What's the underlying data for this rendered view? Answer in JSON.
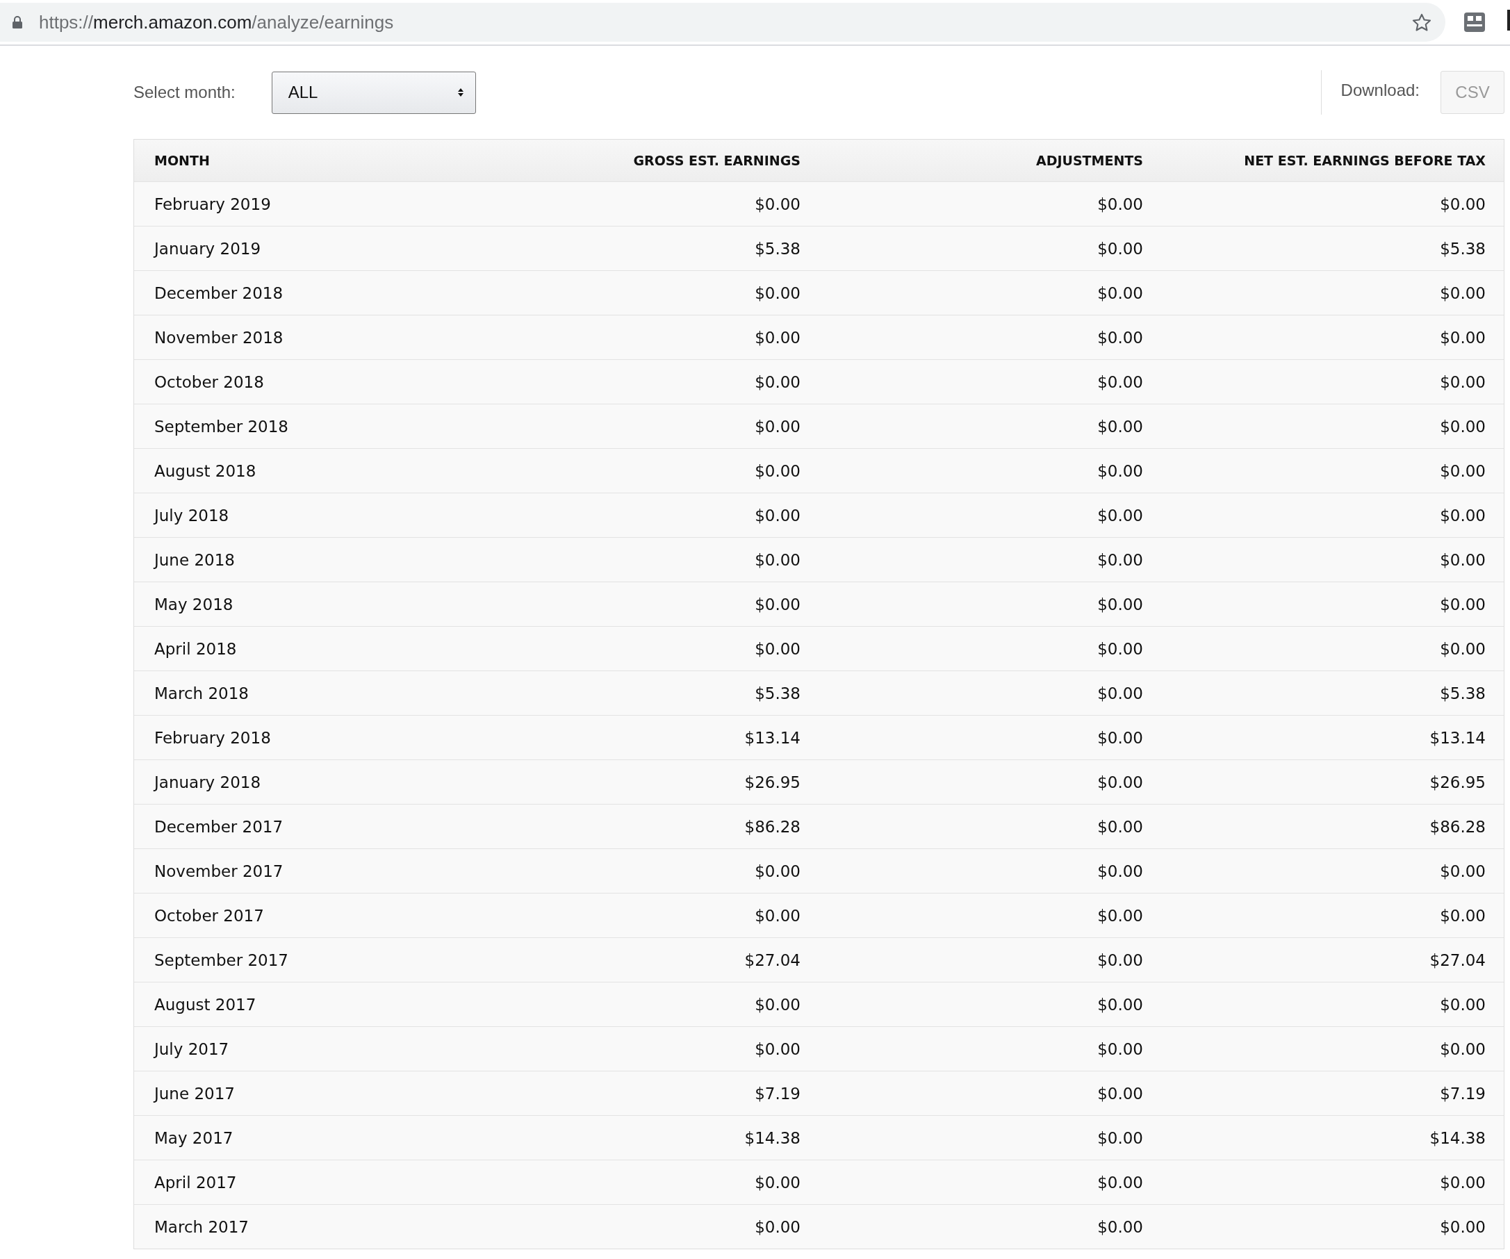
{
  "address_bar": {
    "url_scheme": "https://",
    "url_domain": "merch.amazon.com",
    "url_path": "/analyze/earnings"
  },
  "filters": {
    "select_label": "Select month:",
    "month_select": "ALL",
    "download_label": "Download:",
    "download_button": "CSV"
  },
  "table": {
    "columns": [
      "MONTH",
      "GROSS EST. EARNINGS",
      "ADJUSTMENTS",
      "NET EST. EARNINGS BEFORE TAX"
    ],
    "rows": [
      [
        "February 2019",
        "$0.00",
        "$0.00",
        "$0.00"
      ],
      [
        "January 2019",
        "$5.38",
        "$0.00",
        "$5.38"
      ],
      [
        "December 2018",
        "$0.00",
        "$0.00",
        "$0.00"
      ],
      [
        "November 2018",
        "$0.00",
        "$0.00",
        "$0.00"
      ],
      [
        "October 2018",
        "$0.00",
        "$0.00",
        "$0.00"
      ],
      [
        "September 2018",
        "$0.00",
        "$0.00",
        "$0.00"
      ],
      [
        "August 2018",
        "$0.00",
        "$0.00",
        "$0.00"
      ],
      [
        "July 2018",
        "$0.00",
        "$0.00",
        "$0.00"
      ],
      [
        "June 2018",
        "$0.00",
        "$0.00",
        "$0.00"
      ],
      [
        "May 2018",
        "$0.00",
        "$0.00",
        "$0.00"
      ],
      [
        "April 2018",
        "$0.00",
        "$0.00",
        "$0.00"
      ],
      [
        "March 2018",
        "$5.38",
        "$0.00",
        "$5.38"
      ],
      [
        "February 2018",
        "$13.14",
        "$0.00",
        "$13.14"
      ],
      [
        "January 2018",
        "$26.95",
        "$0.00",
        "$26.95"
      ],
      [
        "December 2017",
        "$86.28",
        "$0.00",
        "$86.28"
      ],
      [
        "November 2017",
        "$0.00",
        "$0.00",
        "$0.00"
      ],
      [
        "October 2017",
        "$0.00",
        "$0.00",
        "$0.00"
      ],
      [
        "September 2017",
        "$27.04",
        "$0.00",
        "$27.04"
      ],
      [
        "August 2017",
        "$0.00",
        "$0.00",
        "$0.00"
      ],
      [
        "July 2017",
        "$0.00",
        "$0.00",
        "$0.00"
      ],
      [
        "June 2017",
        "$7.19",
        "$0.00",
        "$7.19"
      ],
      [
        "May 2017",
        "$14.38",
        "$0.00",
        "$14.38"
      ],
      [
        "April 2017",
        "$0.00",
        "$0.00",
        "$0.00"
      ],
      [
        "March 2017",
        "$0.00",
        "$0.00",
        "$0.00"
      ]
    ]
  }
}
